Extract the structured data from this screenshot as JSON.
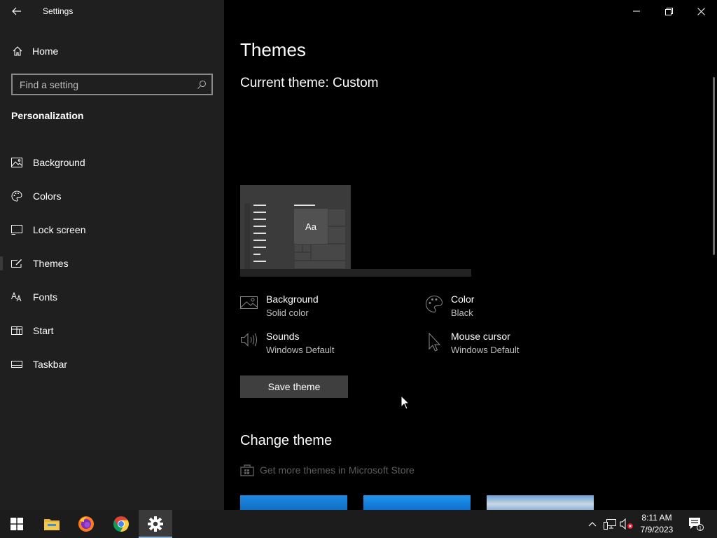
{
  "window": {
    "title": "Settings"
  },
  "sidebar": {
    "home_label": "Home",
    "search_placeholder": "Find a setting",
    "section_title": "Personalization",
    "items": [
      {
        "label": "Background",
        "icon": "picture-icon"
      },
      {
        "label": "Colors",
        "icon": "palette-icon"
      },
      {
        "label": "Lock screen",
        "icon": "lock-screen-icon"
      },
      {
        "label": "Themes",
        "icon": "themes-icon",
        "active": true
      },
      {
        "label": "Fonts",
        "icon": "fonts-icon"
      },
      {
        "label": "Start",
        "icon": "start-icon"
      },
      {
        "label": "Taskbar",
        "icon": "taskbar-icon"
      }
    ]
  },
  "main": {
    "title": "Themes",
    "current_theme": "Current theme: Custom",
    "preview_text": "Aa",
    "properties": {
      "background": {
        "name": "Background",
        "value": "Solid color"
      },
      "color": {
        "name": "Color",
        "value": "Black"
      },
      "sounds": {
        "name": "Sounds",
        "value": "Windows Default"
      },
      "mouse_cursor": {
        "name": "Mouse cursor",
        "value": "Windows Default"
      }
    },
    "save_button": "Save theme",
    "change_theme_title": "Change theme",
    "store_link": "Get more themes in Microsoft Store"
  },
  "taskbar": {
    "apps": [
      "start-icon",
      "file-explorer-icon",
      "firefox-icon",
      "chrome-icon",
      "settings-icon"
    ],
    "time": "8:11 AM",
    "date": "7/9/2023",
    "notification_count": "1"
  },
  "colors": {
    "sidebar_bg": "#1f1f1f",
    "content_bg": "#000000",
    "taskbar_bg": "#1c1c1c",
    "button_bg": "#3f3f3f",
    "accent_blue": "#1e8ae0"
  }
}
